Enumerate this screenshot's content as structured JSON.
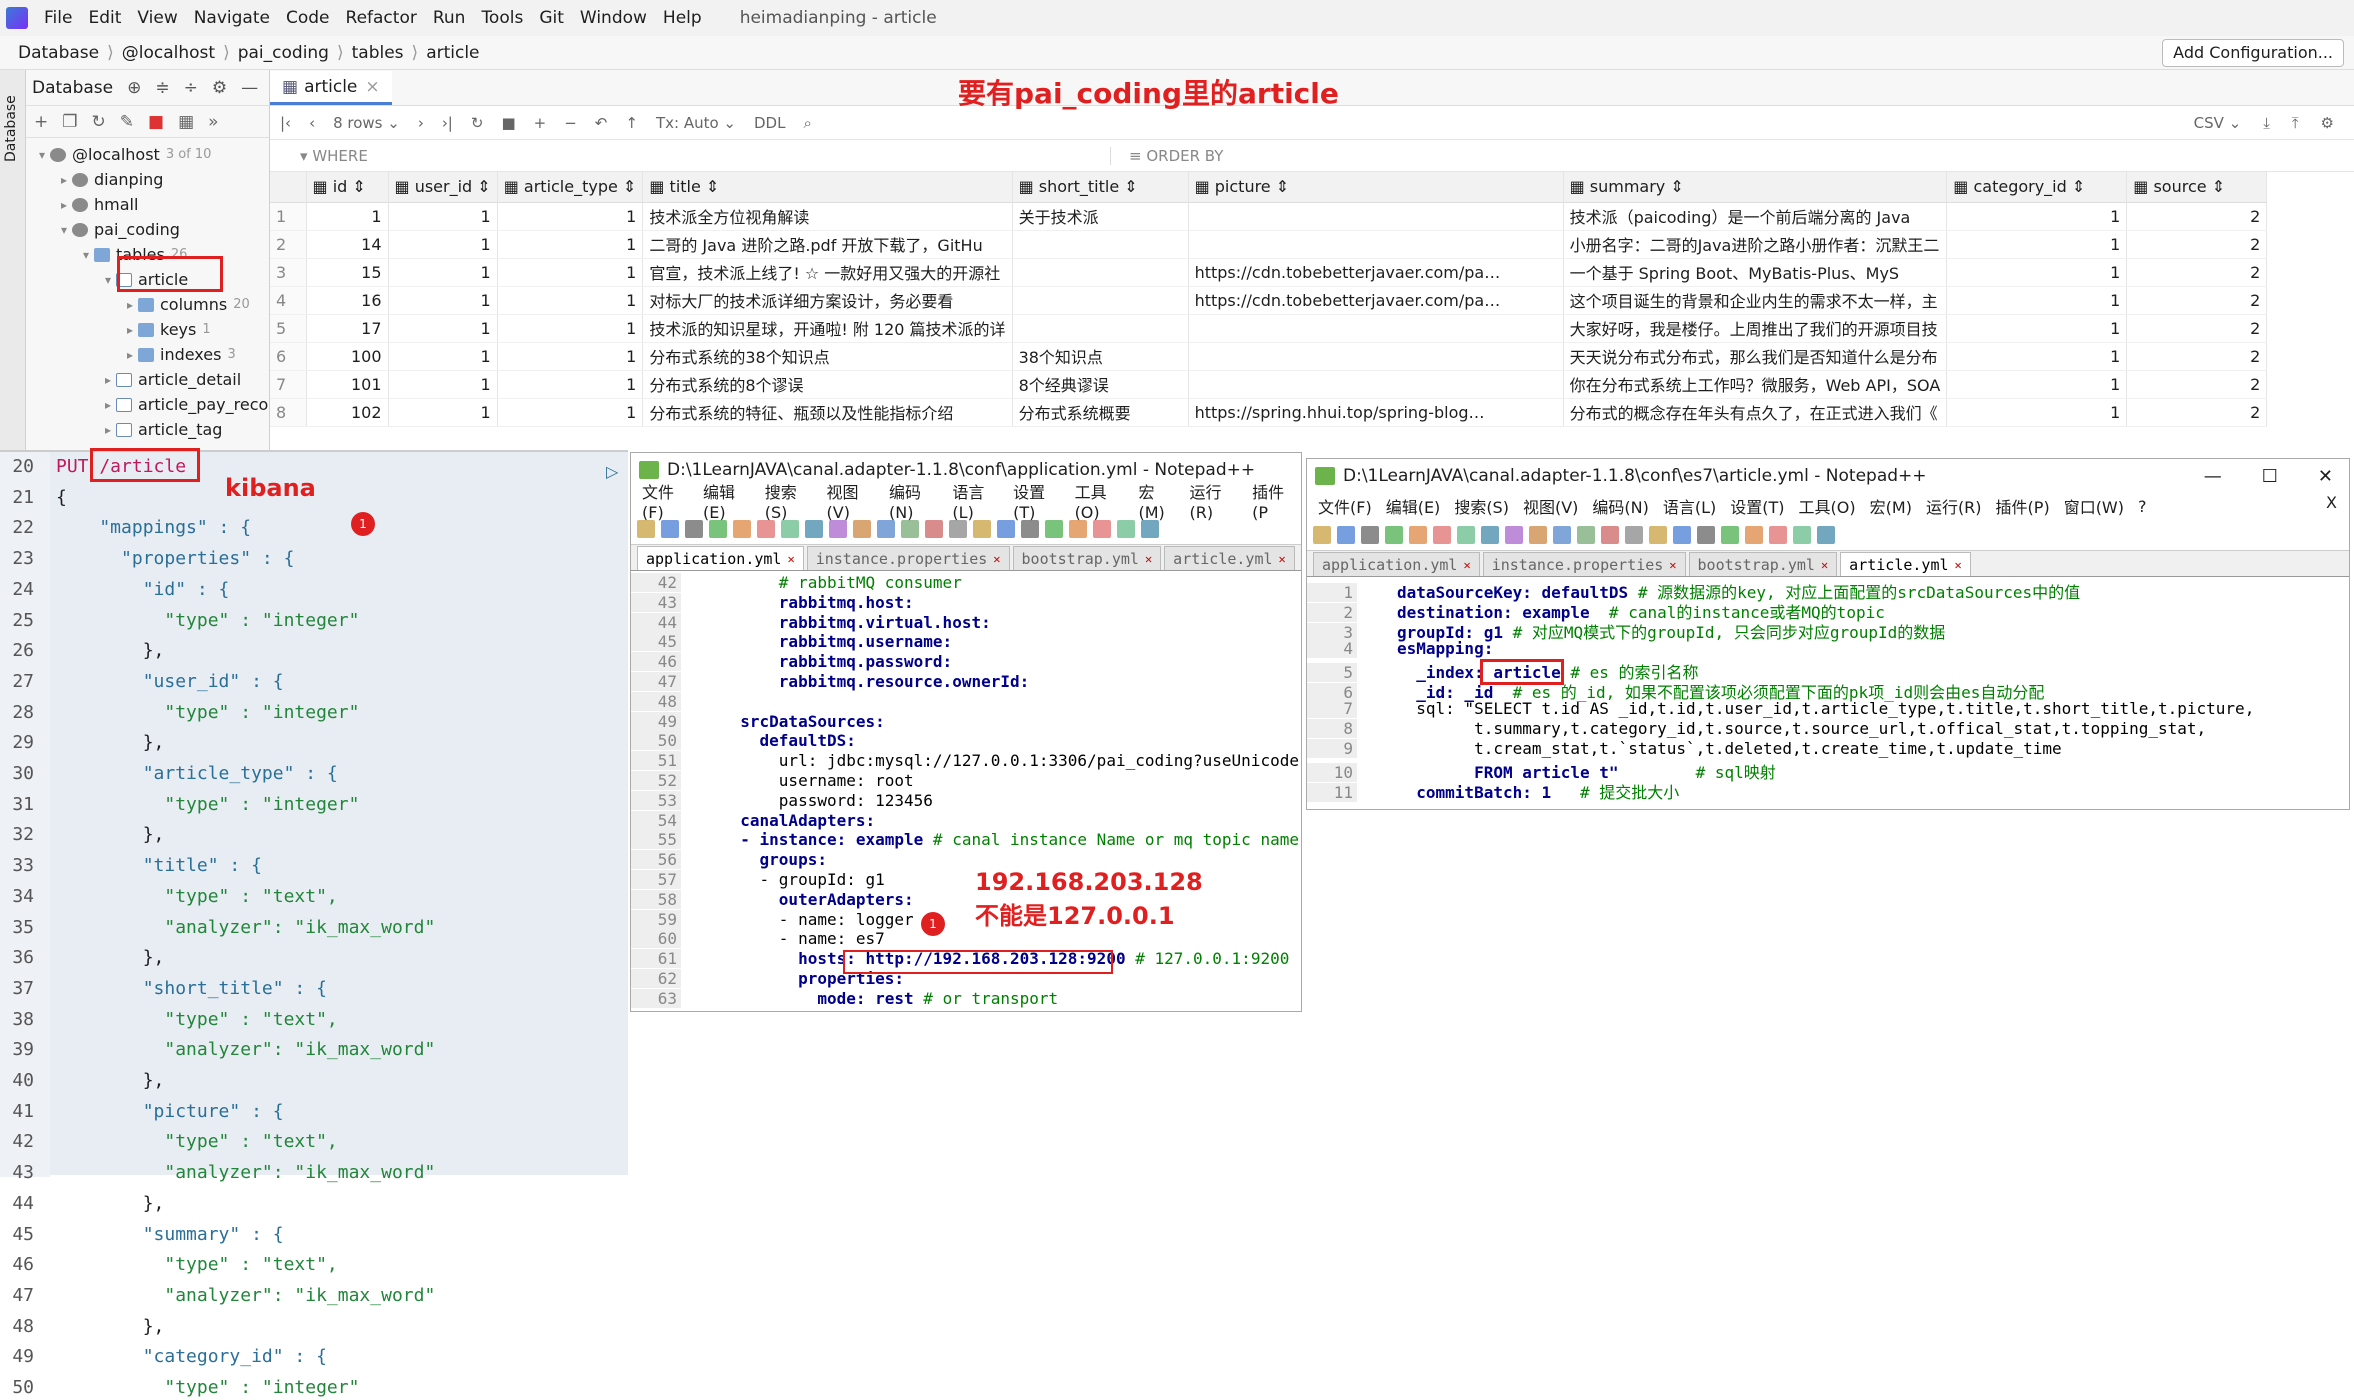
{
  "menubar": {
    "items": [
      "File",
      "Edit",
      "View",
      "Navigate",
      "Code",
      "Refactor",
      "Run",
      "Tools",
      "Git",
      "Window",
      "Help"
    ],
    "title": "heimadianping - article"
  },
  "breadcrumb": [
    "Database",
    "@localhost",
    "pai_coding",
    "tables",
    "article"
  ],
  "add_config": "Add Configuration...",
  "db_panel": {
    "title": "Database",
    "side_label": "Database",
    "tree": [
      {
        "label": "@localhost",
        "count": "3 of 10",
        "level": 0,
        "caret": "▾",
        "type": "dbi"
      },
      {
        "label": "dianping",
        "count": "",
        "level": 1,
        "caret": "▸",
        "type": "dbi"
      },
      {
        "label": "hmall",
        "count": "",
        "level": 1,
        "caret": "▸",
        "type": "dbi"
      },
      {
        "label": "pai_coding",
        "count": "",
        "level": 1,
        "caret": "▾",
        "type": "dbi"
      },
      {
        "label": "tables",
        "count": "26",
        "level": 2,
        "caret": "▾",
        "type": "fold"
      },
      {
        "label": "article",
        "count": "",
        "level": 3,
        "caret": "▾",
        "type": "tbl"
      },
      {
        "label": "columns",
        "count": "20",
        "level": 4,
        "caret": "▸",
        "type": "fold"
      },
      {
        "label": "keys",
        "count": "1",
        "level": 4,
        "caret": "▸",
        "type": "fold"
      },
      {
        "label": "indexes",
        "count": "3",
        "level": 4,
        "caret": "▸",
        "type": "fold"
      },
      {
        "label": "article_detail",
        "count": "",
        "level": 3,
        "caret": "▸",
        "type": "tbl"
      },
      {
        "label": "article_pay_reco",
        "count": "",
        "level": 3,
        "caret": "▸",
        "type": "tbl"
      },
      {
        "label": "article_tag",
        "count": "",
        "level": 3,
        "caret": "▸",
        "type": "tbl"
      }
    ]
  },
  "grid": {
    "tab": "article",
    "annotation": "要有pai_coding里的article",
    "rows_label": "8 rows ⌄",
    "tx": "Tx: Auto ⌄",
    "ddl": "DDL",
    "csv": "CSV ⌄",
    "where": "WHERE",
    "order": "ORDER BY",
    "columns": [
      "id",
      "user_id",
      "article_type",
      "title",
      "short_title",
      "picture",
      "summary",
      "category_id",
      "source"
    ],
    "rows": [
      [
        "1",
        "1",
        "1",
        "1",
        "技术派全方位视角解读",
        "关于技术派",
        "",
        "技术派（paicoding）是一个前后端分离的 Java",
        "1",
        "2"
      ],
      [
        "2",
        "14",
        "1",
        "1",
        "二哥的 Java 进阶之路.pdf 开放下载了，GitHu",
        "",
        "",
        "小册名字：二哥的Java进阶之路小册作者：沉默王二",
        "1",
        "2"
      ],
      [
        "3",
        "15",
        "1",
        "1",
        "官宣，技术派上线了! ☆  一款好用又强大的开源社",
        "",
        "https://cdn.tobebetterjavaer.com/pa…",
        "一个基于 Spring Boot、MyBatis-Plus、MyS",
        "1",
        "2"
      ],
      [
        "4",
        "16",
        "1",
        "1",
        "对标大厂的技术派详细方案设计，务必要看",
        "",
        "https://cdn.tobebetterjavaer.com/pa…",
        "这个项目诞生的背景和企业内生的需求不太一样，主",
        "1",
        "2"
      ],
      [
        "5",
        "17",
        "1",
        "1",
        "技术派的知识星球，开通啦! 附 120 篇技术派的详",
        "",
        "",
        "大家好呀，我是楼仔。上周推出了我们的开源项目技",
        "1",
        "2"
      ],
      [
        "6",
        "100",
        "1",
        "1",
        "分布式系统的38个知识点",
        "38个知识点",
        "",
        "天天说分布式分布式，那么我们是否知道什么是分布",
        "1",
        "2"
      ],
      [
        "7",
        "101",
        "1",
        "1",
        "分布式系统的8个谬误",
        "8个经典谬误",
        "",
        "你在分布式系统上工作吗？微服务，Web API，SOA",
        "1",
        "2"
      ],
      [
        "8",
        "102",
        "1",
        "1",
        "分布式系统的特征、瓶颈以及性能指标介绍",
        "分布式系统概要",
        "https://spring.hhui.top/spring-blog…",
        "分布式的概念存在年头有点久了，在正式进入我们《",
        "1",
        "2"
      ]
    ]
  },
  "kibana": {
    "label": "kibana",
    "badge": "1",
    "lines": [
      [
        "20",
        "PUT /article"
      ],
      [
        "21",
        "{"
      ],
      [
        "22",
        "    \"mappings\" : {"
      ],
      [
        "23",
        "      \"properties\" : {"
      ],
      [
        "24",
        "        \"id\" : {"
      ],
      [
        "25",
        "          \"type\" : \"integer\""
      ],
      [
        "26",
        "        },"
      ],
      [
        "27",
        "        \"user_id\" : {"
      ],
      [
        "28",
        "          \"type\" : \"integer\""
      ],
      [
        "29",
        "        },"
      ],
      [
        "30",
        "        \"article_type\" : {"
      ],
      [
        "31",
        "          \"type\" : \"integer\""
      ],
      [
        "32",
        "        },"
      ],
      [
        "33",
        "        \"title\" : {"
      ],
      [
        "34",
        "          \"type\" : \"text\","
      ],
      [
        "35",
        "          \"analyzer\": \"ik_max_word\""
      ],
      [
        "36",
        "        },"
      ],
      [
        "37",
        "        \"short_title\" : {"
      ],
      [
        "38",
        "          \"type\" : \"text\","
      ],
      [
        "39",
        "          \"analyzer\": \"ik_max_word\""
      ],
      [
        "40",
        "        },"
      ],
      [
        "41",
        "        \"picture\" : {"
      ],
      [
        "42",
        "          \"type\" : \"text\","
      ],
      [
        "43",
        "          \"analyzer\": \"ik_max_word\""
      ],
      [
        "44",
        "        },"
      ],
      [
        "45",
        "        \"summary\" : {"
      ],
      [
        "46",
        "          \"type\" : \"text\","
      ],
      [
        "47",
        "          \"analyzer\": \"ik_max_word\""
      ],
      [
        "48",
        "        },"
      ],
      [
        "49",
        "        \"category_id\" : {"
      ],
      [
        "50",
        "          \"type\" : \"integer\""
      ]
    ]
  },
  "np1": {
    "title": "D:\\1LearnJAVA\\canal.adapter-1.1.8\\conf\\application.yml - Notepad++",
    "menu": [
      "文件(F)",
      "编辑(E)",
      "搜索(S)",
      "视图(V)",
      "编码(N)",
      "语言(L)",
      "设置(T)",
      "工具(O)",
      "宏(M)",
      "运行(R)",
      "插件(P"
    ],
    "tabs": [
      "application.yml",
      "instance.properties",
      "bootstrap.yml",
      "article.yml"
    ],
    "note": "192.168.203.128\n不能是127.0.0.1",
    "badge": "1",
    "lines": [
      [
        "42",
        "      # rabbitMQ consumer"
      ],
      [
        "43",
        "      rabbitmq.host:"
      ],
      [
        "44",
        "      rabbitmq.virtual.host:"
      ],
      [
        "45",
        "      rabbitmq.username:"
      ],
      [
        "46",
        "      rabbitmq.password:"
      ],
      [
        "47",
        "      rabbitmq.resource.ownerId:"
      ],
      [
        "48",
        ""
      ],
      [
        "49",
        "  srcDataSources:"
      ],
      [
        "50",
        "    defaultDS:"
      ],
      [
        "51",
        "      url: jdbc:mysql://127.0.0.1:3306/pai_coding?useUnicode"
      ],
      [
        "52",
        "      username: root"
      ],
      [
        "53",
        "      password: 123456"
      ],
      [
        "54",
        "  canalAdapters:"
      ],
      [
        "55",
        "  - instance: example # canal instance Name or mq topic name"
      ],
      [
        "56",
        "    groups:"
      ],
      [
        "57",
        "    - groupId: g1"
      ],
      [
        "58",
        "      outerAdapters:"
      ],
      [
        "59",
        "      - name: logger"
      ],
      [
        "60",
        "      - name: es7"
      ],
      [
        "61",
        "        hosts: http://192.168.203.128:9200 # 127.0.0.1:9200"
      ],
      [
        "62",
        "        properties:"
      ],
      [
        "63",
        "          mode: rest # or transport"
      ]
    ]
  },
  "np2": {
    "title": "D:\\1LearnJAVA\\canal.adapter-1.1.8\\conf\\es7\\article.yml - Notepad++",
    "menu": [
      "文件(F)",
      "编辑(E)",
      "搜索(S)",
      "视图(V)",
      "编码(N)",
      "语言(L)",
      "设置(T)",
      "工具(O)",
      "宏(M)",
      "运行(R)",
      "插件(P)",
      "窗口(W)",
      "?"
    ],
    "close": "X",
    "tabs": [
      "application.yml",
      "instance.properties",
      "bootstrap.yml",
      "article.yml"
    ],
    "lines": [
      [
        "1",
        "dataSourceKey: defaultDS # 源数据源的key, 对应上面配置的srcDataSources中的值"
      ],
      [
        "2",
        "destination: example  # canal的instance或者MQ的topic"
      ],
      [
        "3",
        "groupId: g1 # 对应MQ模式下的groupId, 只会同步对应groupId的数据"
      ],
      [
        "4",
        "esMapping:"
      ],
      [
        "5",
        "  _index: article # es 的索引名称"
      ],
      [
        "6",
        "  _id: _id  # es 的_id, 如果不配置该项必须配置下面的pk项_id则会由es自动分配"
      ],
      [
        "7",
        "  sql: \"SELECT t.id AS _id,t.id,t.user_id,t.article_type,t.title,t.short_title,t.picture,"
      ],
      [
        "8",
        "        t.summary,t.category_id,t.source,t.source_url,t.offical_stat,t.topping_stat,"
      ],
      [
        "9",
        "        t.cream_stat,t.`status`,t.deleted,t.create_time,t.update_time"
      ],
      [
        "10",
        "        FROM article t\"        # sql映射"
      ],
      [
        "11",
        "  commitBatch: 1   # 提交批大小"
      ]
    ]
  }
}
